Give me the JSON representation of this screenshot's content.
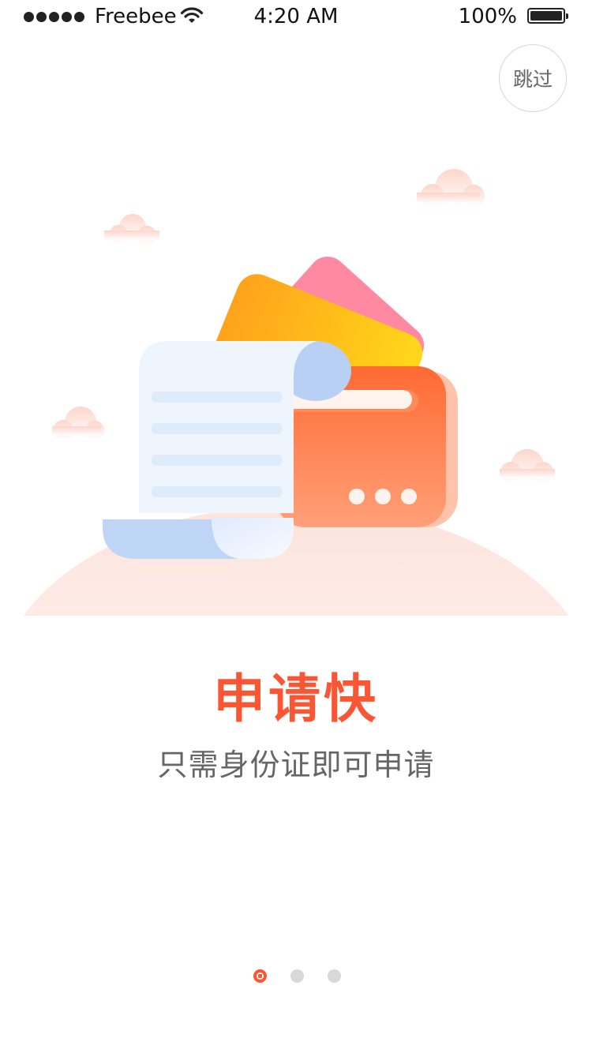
{
  "status_bar": {
    "carrier": "Freebee",
    "time": "4:20 AM",
    "battery_percent": "100%",
    "battery_level": 1.0,
    "signal_bars": 5
  },
  "skip_button": {
    "label": "跳过"
  },
  "onboarding": {
    "title": "申请快",
    "subtitle": "只需身份证即可申请",
    "accent_color": "#fb5633"
  },
  "pager": {
    "total": 3,
    "current": 1
  },
  "icons": [
    "wifi-icon",
    "battery-icon",
    "wallet-illustration",
    "receipt-illustration",
    "cloud-icon"
  ]
}
